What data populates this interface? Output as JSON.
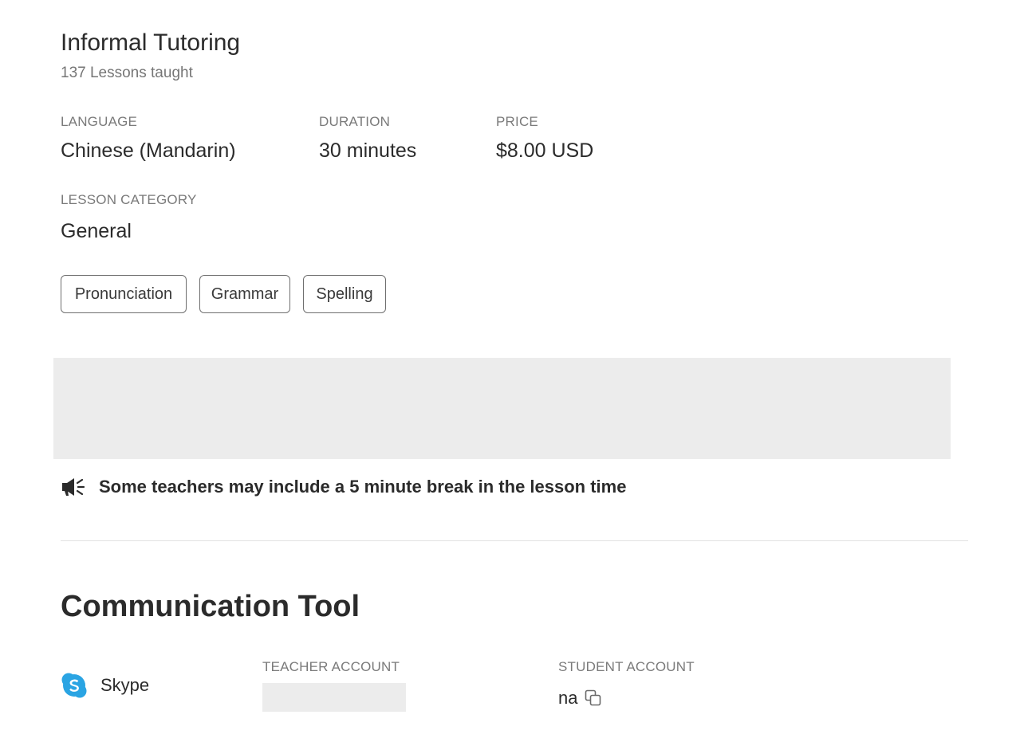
{
  "lesson": {
    "title": "Informal Tutoring",
    "lessons_taught": "137 Lessons taught"
  },
  "details": {
    "language": {
      "label": "LANGUAGE",
      "value": "Chinese (Mandarin)"
    },
    "duration": {
      "label": "DURATION",
      "value": "30 minutes"
    },
    "price": {
      "label": "PRICE",
      "value": "$8.00 USD"
    },
    "category": {
      "label": "LESSON CATEGORY",
      "value": "General"
    }
  },
  "tags": [
    "Pronunciation",
    "Grammar",
    "Spelling"
  ],
  "notice": {
    "icon": "megaphone-icon",
    "text": "Some teachers may include a 5 minute break in the lesson time"
  },
  "communication": {
    "title": "Communication Tool",
    "tool": {
      "icon": "skype-icon",
      "name": "Skype",
      "brand_color": "#2aa4e3"
    },
    "teacher_account": {
      "label": "TEACHER ACCOUNT",
      "value": ""
    },
    "student_account": {
      "label": "STUDENT ACCOUNT",
      "value": "na",
      "copy_icon": "copy-icon"
    }
  }
}
